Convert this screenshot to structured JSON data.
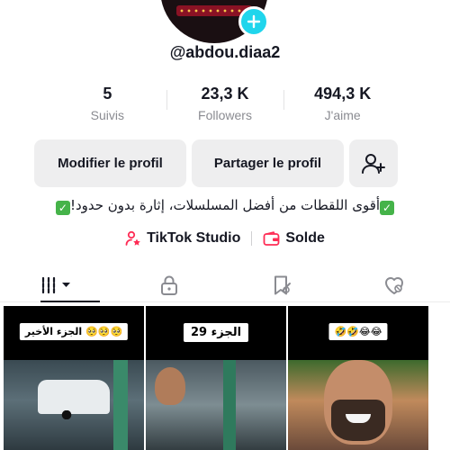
{
  "profile": {
    "username": "@abdou.diaa2",
    "stats": [
      {
        "value": "5",
        "label": "Suivis"
      },
      {
        "value": "23,3 K",
        "label": "Followers"
      },
      {
        "value": "494,3 K",
        "label": "J'aime"
      }
    ],
    "bio": "أقوى اللقطات من أفضل المسلسلات، إثارة بدون حدود!",
    "accent_color": "#20d5ec"
  },
  "actions": {
    "edit_label": "Modifier le profil",
    "share_label": "Partager le profil"
  },
  "links": {
    "studio_label": "TikTok Studio",
    "balance_label": "Solde"
  },
  "tabs": [
    {
      "icon": "grid-icon",
      "active": true
    },
    {
      "icon": "lock-icon",
      "active": false
    },
    {
      "icon": "bookmark-icon",
      "active": false
    },
    {
      "icon": "heart-icon",
      "active": false
    }
  ],
  "videos": [
    {
      "label": "الجزء الأخير 🥺🥺🥺"
    },
    {
      "label": "الجزء 29"
    },
    {
      "label": "🤣🤣😂😂"
    }
  ]
}
